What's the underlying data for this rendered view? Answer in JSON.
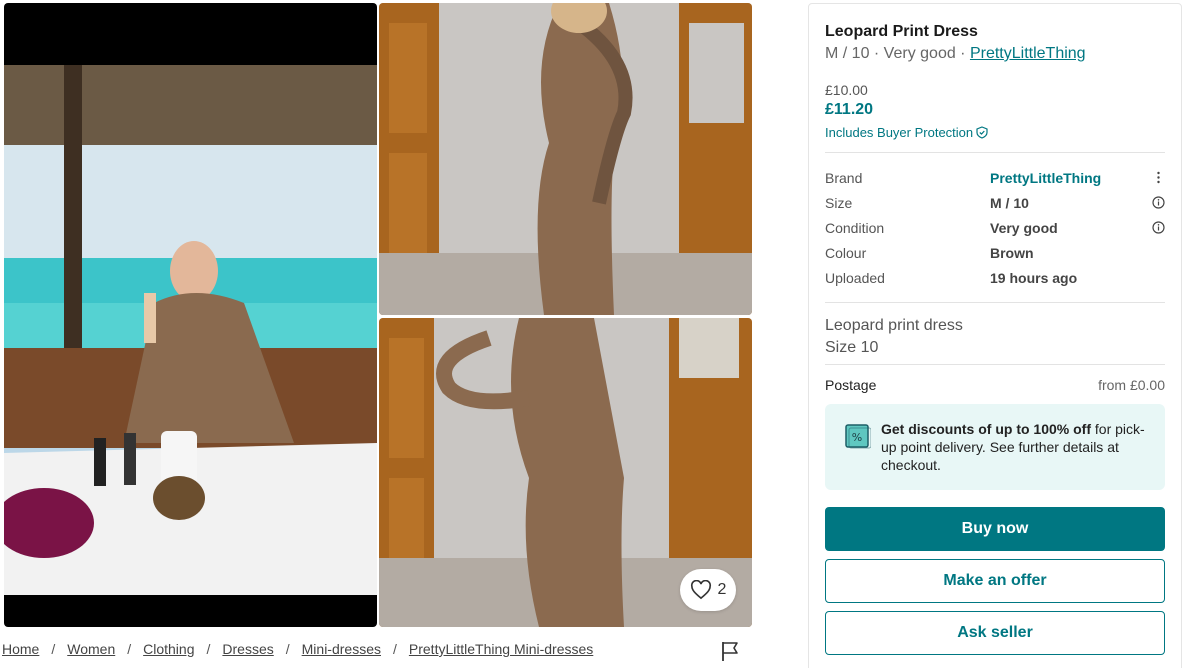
{
  "gallery": {
    "favorite_count": "2",
    "photos": [
      "photo-1",
      "photo-2",
      "photo-3"
    ]
  },
  "breadcrumb": [
    "Home",
    "Women",
    "Clothing",
    "Dresses",
    "Mini-dresses",
    "PrettyLittleThing Mini-dresses"
  ],
  "item": {
    "title": "Leopard Print Dress",
    "size_condition": "M / 10 · Very good · ",
    "brand_link": "PrettyLittleThing",
    "price": "£10.00",
    "price_with_protection": "£11.20",
    "buyer_protection": "Includes Buyer Protection"
  },
  "details": [
    {
      "label": "Brand",
      "value": "PrettyLittleThing"
    },
    {
      "label": "Size",
      "value": "M / 10"
    },
    {
      "label": "Condition",
      "value": "Very good"
    },
    {
      "label": "Colour",
      "value": "Brown"
    },
    {
      "label": "Uploaded",
      "value": "19 hours ago"
    }
  ],
  "description": {
    "line1": "Leopard print dress",
    "line2": "Size 10"
  },
  "postage": {
    "label": "Postage",
    "value": "from £0.00"
  },
  "promo": {
    "bold": "Get discounts of up to 100% off",
    "rest": " for pick-up point delivery. See further details at checkout."
  },
  "actions": {
    "buy": "Buy now",
    "offer": "Make an offer",
    "ask": "Ask seller"
  },
  "colors": {
    "accent": "#007782",
    "promo_bg": "#e8f7f6"
  }
}
